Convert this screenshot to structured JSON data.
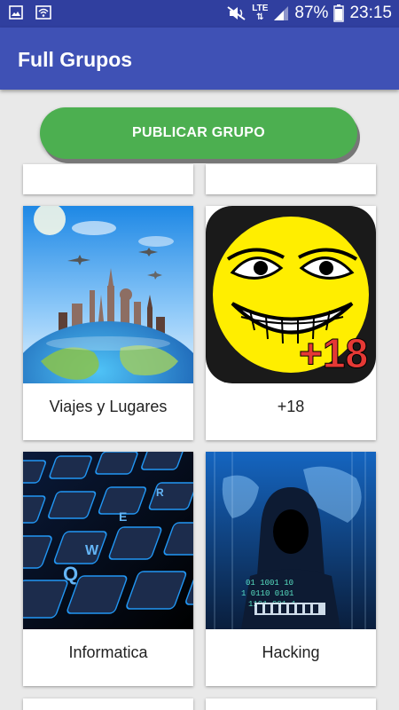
{
  "status_bar": {
    "battery_percent": "87%",
    "time": "23:15",
    "network": "LTE",
    "icons": [
      "image-icon",
      "wifi-icon",
      "mute-icon",
      "lte-icon",
      "signal-icon",
      "battery-icon"
    ]
  },
  "app_bar": {
    "title": "Full Grupos"
  },
  "publish_button": {
    "label": "PUBLICAR GRUPO"
  },
  "categories": [
    {
      "label": "Viajes y Lugares",
      "image": "travel-world-image"
    },
    {
      "label": "+18",
      "image": "troll-face-image"
    },
    {
      "label": "Informatica",
      "image": "keyboard-image"
    },
    {
      "label": "Hacking",
      "image": "hacker-image"
    }
  ],
  "colors": {
    "status_bar": "#303f9f",
    "app_bar": "#3f51b5",
    "button": "#4caf50",
    "background": "#e9e9e9"
  }
}
